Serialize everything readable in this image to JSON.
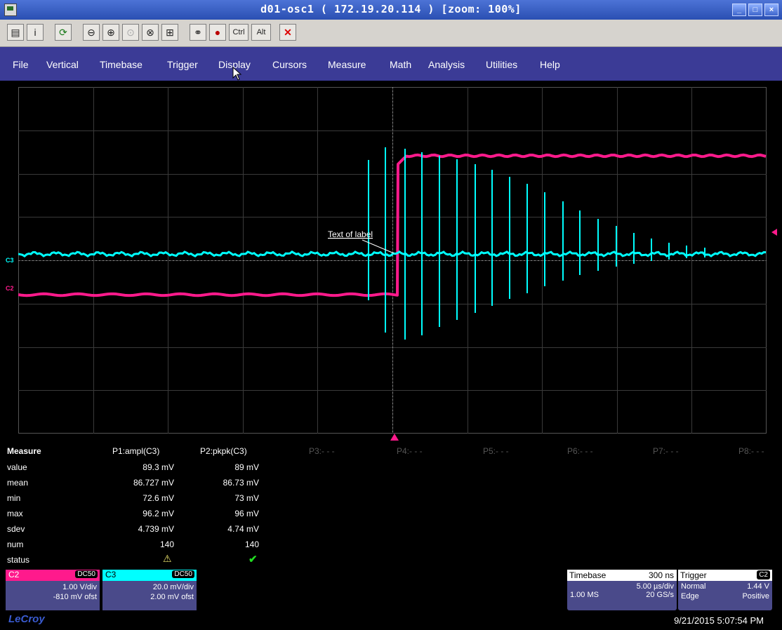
{
  "window": {
    "title": "d01-osc1 ( 172.19.20.114 ) [zoom: 100%]",
    "controls": [
      "minimize-icon",
      "maximize-icon",
      "close-icon"
    ]
  },
  "toolbar": {
    "buttons": [
      {
        "name": "properties-icon"
      },
      {
        "name": "info-icon"
      },
      {
        "name": "refresh-icon"
      },
      {
        "name": "zoom-out-icon"
      },
      {
        "name": "zoom-in-icon"
      },
      {
        "name": "zoom-disabled-icon"
      },
      {
        "name": "zoom-region-icon"
      },
      {
        "name": "zoom-fit-icon"
      },
      {
        "name": "keys-icon"
      },
      {
        "name": "record-icon"
      },
      {
        "name": "ctrl-key",
        "label": "Ctrl"
      },
      {
        "name": "alt-key",
        "label": "Alt"
      },
      {
        "name": "disconnect-icon"
      }
    ]
  },
  "menu": [
    "File",
    "Vertical",
    "Timebase",
    "Trigger",
    "Display",
    "Cursors",
    "Measure",
    "Math",
    "Analysis",
    "Utilities",
    "Help"
  ],
  "screen": {
    "label": "Text of label",
    "channel_markers": [
      "C3",
      "C2"
    ],
    "colors": {
      "c2": "#ff1a8c",
      "c3": "#00ffff",
      "grid": "#3a3a3a",
      "bg": "#000000"
    }
  },
  "measure": {
    "heading": "Measure",
    "params": [
      "P1:ampl(C3)",
      "P2:pkpk(C3)",
      "P3:- - -",
      "P4:- - -",
      "P5:- - -",
      "P6:- - -",
      "P7:- - -",
      "P8:- - -"
    ],
    "row_labels": [
      "value",
      "mean",
      "min",
      "max",
      "sdev",
      "num",
      "status"
    ],
    "p1": [
      "89.3 mV",
      "86.727 mV",
      "72.6 mV",
      "96.2 mV",
      "4.739 mV",
      "140"
    ],
    "p2": [
      "89 mV",
      "86.73 mV",
      "73 mV",
      "96 mV",
      "4.74 mV",
      "140"
    ],
    "status": {
      "p1": "warning-icon",
      "p2": "check-icon"
    }
  },
  "channels": [
    {
      "name": "C2",
      "coupling": "DC50",
      "vdiv": "1.00 V/div",
      "offset": "-810 mV ofst",
      "color": "#ff1a8c"
    },
    {
      "name": "C3",
      "coupling": "DC50",
      "vdiv": "20.0 mV/div",
      "offset": "2.00 mV ofst",
      "color": "#00ffff"
    }
  ],
  "timebase": {
    "label": "Timebase",
    "delay": "300 ns",
    "tdiv": "5.00 µs/div",
    "samples": "1.00 MS",
    "rate": "20 GS/s"
  },
  "trigger": {
    "label": "Trigger",
    "source": "C2",
    "mode": "Normal",
    "level": "1.44 V",
    "type": "Edge",
    "slope": "Positive"
  },
  "brand": "LeCroy",
  "datetime": "9/21/2015 5:07:54 PM"
}
